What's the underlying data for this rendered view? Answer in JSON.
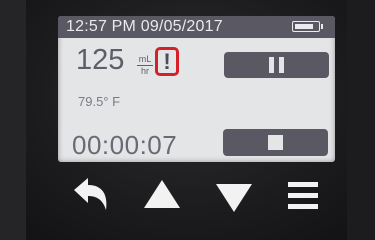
{
  "status_bar": {
    "datetime": "12:57 PM 09/05/2017",
    "battery_level": 0.85
  },
  "rate": {
    "value": "125",
    "unit_top": "mL",
    "unit_bottom": "hr"
  },
  "alert": {
    "symbol": "!",
    "color": "#d4202a"
  },
  "temperature": "79.5° F",
  "timer": "00:00:07",
  "buttons": {
    "pause": "pause-icon",
    "stop": "stop-icon",
    "back": "back-arrow-icon",
    "up": "up-arrow-icon",
    "down": "down-arrow-icon",
    "menu": "menu-icon"
  },
  "colors": {
    "screen_bg": "#e4e5e7",
    "accent": "#5a5862",
    "alert_red": "#d4202a"
  }
}
